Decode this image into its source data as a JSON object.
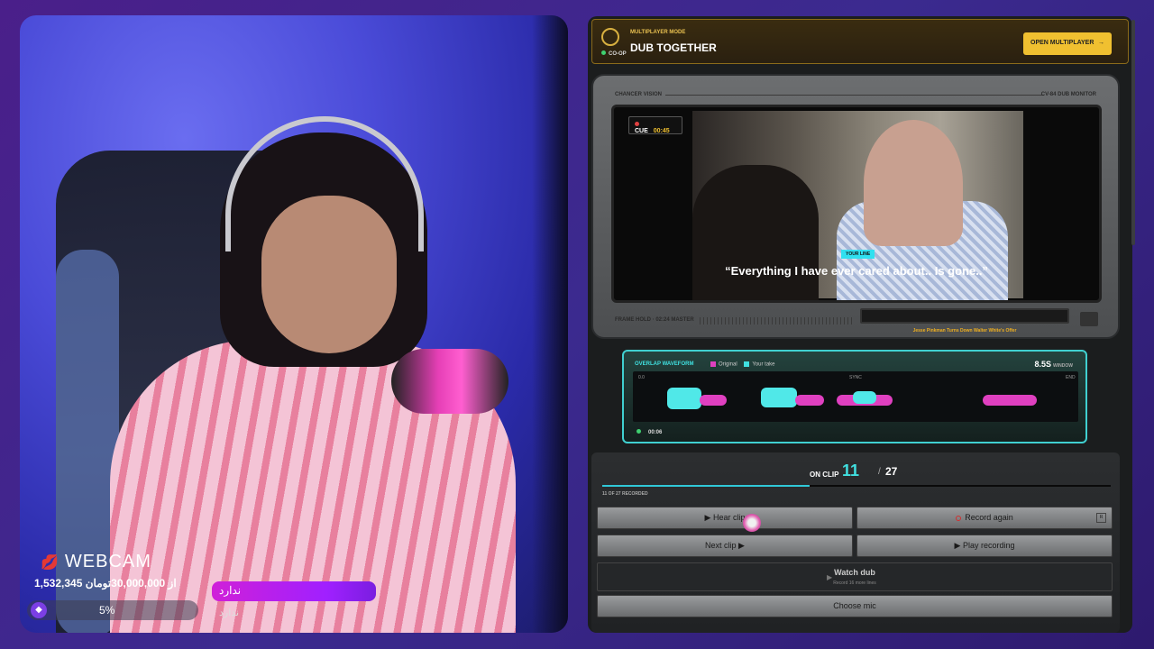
{
  "webcam": {
    "label": "WEBCAM",
    "donation_text": "1,532,345 از 30,000,000تومان",
    "bar_text": "ندارد",
    "bar_sub": "ندارد",
    "progress_pct": "5%",
    "progress_fraction": 0.05
  },
  "app": {
    "topbar": {
      "mode_label": "MULTIPLAYER MODE",
      "title": "DUB TOGETHER",
      "coop_badge": "CO-OP",
      "open_button": "OPEN MULTIPLAYER",
      "open_arrow": "→"
    },
    "monitor": {
      "brand": "CHANCER VISION",
      "model": "CV-84 DUB MONITOR",
      "cue_label": "CUE",
      "cue_time": "00:45",
      "your_line_tag": "YOUR LINE",
      "subtitle": "“Everything I have ever cared about.. Is gone..”",
      "footer_left": "FRAME HOLD · 02:24 MASTER",
      "caption": "Jesse Pinkman Turns Down Walter White's Offer"
    },
    "waveform": {
      "header": "OVERLAP WAVEFORM",
      "legend_original": "Original",
      "legend_take": "Your take",
      "color_original": "#e040c0",
      "color_take": "#40e0e0",
      "window_value": "8.5S",
      "window_label": "WINDOW",
      "start_label": "0.0",
      "sync_label": "SYNC",
      "end_label": "END",
      "time": "00:06"
    },
    "clip": {
      "on_clip_label": "ON CLIP",
      "current": "11",
      "separator": "/",
      "total": "27",
      "progress_fraction": 0.407,
      "recorded_text": "11 OF 27 RECORDED",
      "buttons": {
        "hear_clip": "▶ Hear clip",
        "record_again": "Record again",
        "record_key": "R",
        "next_clip": "Next clip ▶",
        "play_recording": "▶ Play recording",
        "watch_dub": "Watch dub",
        "watch_dub_sub": "Record 16 more lines",
        "choose_mic": "Choose mic"
      }
    }
  }
}
